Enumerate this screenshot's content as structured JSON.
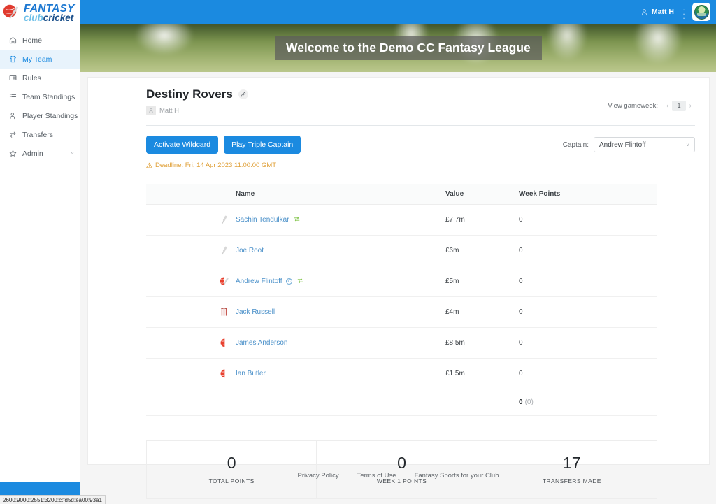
{
  "brand": {
    "logo_fantasy": "FANTASY",
    "logo_club": "club",
    "logo_cricket": "cricket",
    "accent_blue": "#1b8ae0",
    "ball_red": "#e03b2f"
  },
  "sidebar": {
    "items": [
      {
        "id": "home",
        "label": "Home",
        "icon": "home-icon",
        "active": false
      },
      {
        "id": "my-team",
        "label": "My Team",
        "icon": "shirt-icon",
        "active": true
      },
      {
        "id": "rules",
        "label": "Rules",
        "icon": "book-icon",
        "active": false
      },
      {
        "id": "team-standings",
        "label": "Team Standings",
        "icon": "list-icon",
        "active": false
      },
      {
        "id": "player-standings",
        "label": "Player Standings",
        "icon": "people-icon",
        "active": false
      },
      {
        "id": "transfers",
        "label": "Transfers",
        "icon": "transfer-icon",
        "active": false
      },
      {
        "id": "admin",
        "label": "Admin",
        "icon": "star-icon",
        "active": false,
        "chevron": "˅"
      }
    ]
  },
  "topbar": {
    "user_name": "Matt H",
    "user_icon": "person-icon",
    "menu_icon": "vertical-dots-icon",
    "badge_icon": "club-badge-icon"
  },
  "banner": {
    "title": "Welcome to the Demo CC Fantasy League"
  },
  "team": {
    "name": "Destiny Rovers",
    "edit_icon": "pencil-icon",
    "owner": "Matt H",
    "owner_avatar_icon": "person-avatar-icon"
  },
  "gameweek": {
    "label": "View gameweek:",
    "prev": "‹",
    "number": "1",
    "next": "›"
  },
  "actions": {
    "wildcard_label": "Activate Wildcard",
    "triple_captain_label": "Play Triple Captain",
    "captain_label": "Captain:",
    "captain_value": "Andrew Flintoff",
    "captain_chevron": "˅",
    "deadline": "Deadline: Fri, 14 Apr 2023 11:00:00 GMT",
    "deadline_icon": "warning-triangle-icon",
    "deadline_color": "#e0a13a"
  },
  "table": {
    "headers": {
      "icon": "",
      "name": "Name",
      "value": "Value",
      "week_points": "Week Points"
    },
    "rows": [
      {
        "icon": "bat-icon",
        "role": "batsman",
        "name": "Sachin Tendulkar",
        "captain": false,
        "swap": true,
        "value": "£7.7m",
        "week_points": "0"
      },
      {
        "icon": "bat-icon",
        "role": "batsman",
        "name": "Joe Root",
        "captain": false,
        "swap": false,
        "value": "£6m",
        "week_points": "0"
      },
      {
        "icon": "allrounder-icon",
        "role": "all-rounder",
        "name": "Andrew Flintoff",
        "captain": true,
        "captain_badge": "C",
        "swap": true,
        "value": "£5m",
        "week_points": "0"
      },
      {
        "icon": "stumps-icon",
        "role": "wicketkeeper",
        "name": "Jack Russell",
        "captain": false,
        "swap": false,
        "value": "£4m",
        "week_points": "0"
      },
      {
        "icon": "ball-icon",
        "role": "bowler",
        "name": "James Anderson",
        "captain": false,
        "swap": false,
        "value": "£8.5m",
        "week_points": "0"
      },
      {
        "icon": "ball-icon",
        "role": "bowler",
        "name": "Ian Butler",
        "captain": false,
        "swap": false,
        "value": "£1.5m",
        "week_points": "0"
      }
    ],
    "total": {
      "points": "0",
      "bonus": "(0)"
    }
  },
  "stats": [
    {
      "value": "0",
      "label": "TOTAL POINTS"
    },
    {
      "value": "0",
      "label": "WEEK 1 POINTS"
    },
    {
      "value": "17",
      "label": "TRANSFERS MADE"
    }
  ],
  "footer": {
    "links": [
      "Privacy Policy",
      "Terms of Use",
      "Fantasy Sports for your Club"
    ]
  },
  "statusbar": {
    "text": "2600:9000:2551:3200:c:fd5d:ea00:93a1"
  }
}
